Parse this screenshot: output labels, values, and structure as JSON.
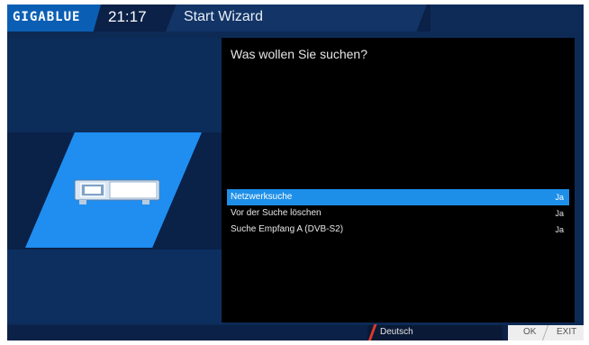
{
  "header": {
    "logo": "GIGABLUE",
    "time": "21:17",
    "title": "Start Wizard"
  },
  "panel": {
    "question": "Was wollen Sie suchen?",
    "options": [
      {
        "label": "Netzwerksuche",
        "value": "Ja",
        "selected": true
      },
      {
        "label": "Vor der Suche löschen",
        "value": "Ja",
        "selected": false
      },
      {
        "label": "Suche Empfang A (DVB-S2)",
        "value": "Ja",
        "selected": false
      }
    ]
  },
  "footer": {
    "language": "Deutsch",
    "ok_label": "OK",
    "exit_label": "EXIT"
  },
  "colors": {
    "accent": "#1e8fe8",
    "background": "#0d2a55",
    "panel": "#000000",
    "language_marker": "#e03a2a"
  },
  "icons": [
    "set-top-box-icon"
  ]
}
